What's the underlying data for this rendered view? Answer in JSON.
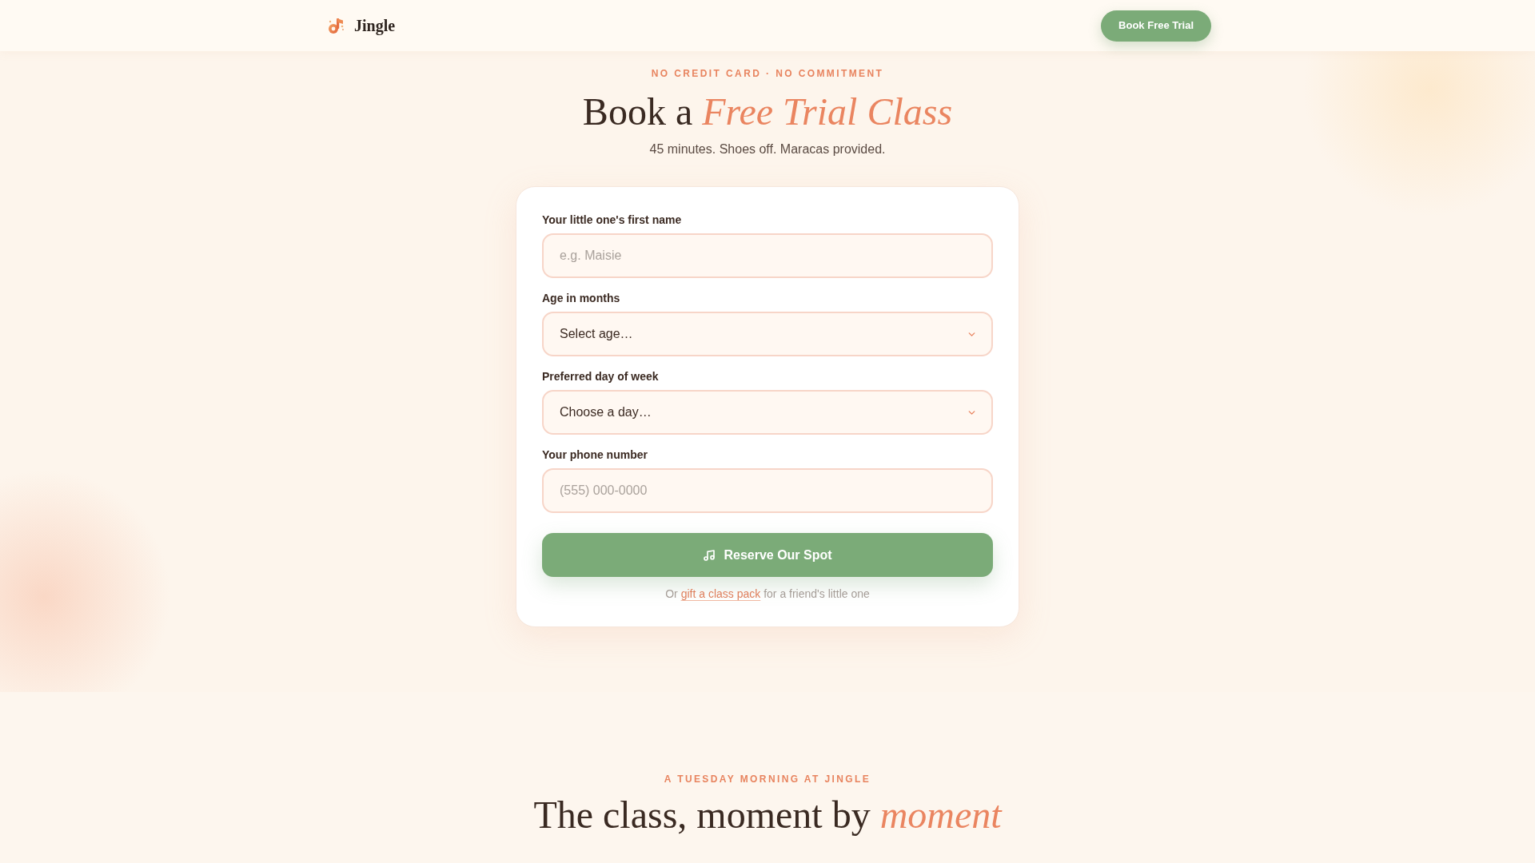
{
  "header": {
    "brand": "Jingle",
    "cta": "Book Free Trial"
  },
  "hero": {
    "eyebrow": "NO CREDIT CARD · NO COMMITMENT",
    "title": "Book a *Free Trial Class*",
    "subtitle": "45 minutes. Shoes off. Maracas provided."
  },
  "booking_form": {
    "fields": [
      {
        "kind": "text",
        "label": "Your little one's first name",
        "placeholder": "e.g. Maisie"
      },
      {
        "kind": "select",
        "label": "Age in months",
        "value": "Select age…"
      },
      {
        "kind": "select",
        "label": "Preferred day of week",
        "value": "Choose a day…"
      },
      {
        "kind": "text",
        "label": "Your phone number",
        "placeholder": "(555) 000-0000"
      }
    ],
    "submit": "Reserve Our Spot",
    "footnote": {
      "lead": "Or",
      "link": "gift a class pack",
      "trail": "for a friend's little one"
    }
  },
  "next_section": {
    "eyebrow": "A TUESDAY MORNING AT JINGLE",
    "title": "The class, moment by *moment*"
  }
}
